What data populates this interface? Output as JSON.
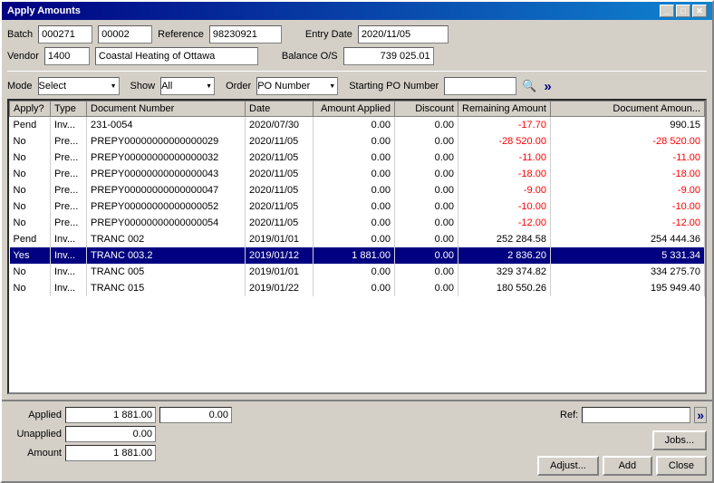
{
  "window": {
    "title": "Apply Amounts"
  },
  "header": {
    "batch_label": "Batch",
    "batch_value1": "000271",
    "batch_value2": "00002",
    "reference_label": "Reference",
    "reference_value": "98230921",
    "entry_date_label": "Entry Date",
    "entry_date_value": "2020/11/05",
    "vendor_label": "Vendor",
    "vendor_value": "1400",
    "vendor_name": "Coastal Heating of Ottawa",
    "balance_os_label": "Balance O/S",
    "balance_os_value": "739 025.01"
  },
  "filters": {
    "mode_label": "Mode",
    "mode_options": [
      "Select"
    ],
    "mode_selected": "Select",
    "show_label": "Show",
    "show_options": [
      "All"
    ],
    "show_selected": "All",
    "order_label": "Order",
    "order_options": [
      "PO Number"
    ],
    "order_selected": "PO Number",
    "starting_po_label": "Starting PO Number"
  },
  "table": {
    "columns": [
      "Apply?",
      "Type",
      "Document Number",
      "Date",
      "Amount Applied",
      "Discount",
      "Remaining Amount",
      "Document Amount"
    ],
    "rows": [
      {
        "apply": "Pend",
        "type": "Inv...",
        "doc": "231-0054",
        "date": "2020/07/30",
        "amount_applied": "0.00",
        "discount": "0.00",
        "remaining": "-17.70",
        "doc_amount": "990.15",
        "remaining_red": true,
        "doc_amount_red": false,
        "selected": false
      },
      {
        "apply": "No",
        "type": "Pre...",
        "doc": "PREPY00000000000000029",
        "date": "2020/11/05",
        "amount_applied": "0.00",
        "discount": "0.00",
        "remaining": "-28 520.00",
        "doc_amount": "-28 520.00",
        "remaining_red": true,
        "doc_amount_red": true,
        "selected": false
      },
      {
        "apply": "No",
        "type": "Pre...",
        "doc": "PREPY00000000000000032",
        "date": "2020/11/05",
        "amount_applied": "0.00",
        "discount": "0.00",
        "remaining": "-11.00",
        "doc_amount": "-11.00",
        "remaining_red": true,
        "doc_amount_red": true,
        "selected": false
      },
      {
        "apply": "No",
        "type": "Pre...",
        "doc": "PREPY00000000000000043",
        "date": "2020/11/05",
        "amount_applied": "0.00",
        "discount": "0.00",
        "remaining": "-18.00",
        "doc_amount": "-18.00",
        "remaining_red": true,
        "doc_amount_red": true,
        "selected": false
      },
      {
        "apply": "No",
        "type": "Pre...",
        "doc": "PREPY00000000000000047",
        "date": "2020/11/05",
        "amount_applied": "0.00",
        "discount": "0.00",
        "remaining": "-9.00",
        "doc_amount": "-9.00",
        "remaining_red": true,
        "doc_amount_red": true,
        "selected": false
      },
      {
        "apply": "No",
        "type": "Pre...",
        "doc": "PREPY00000000000000052",
        "date": "2020/11/05",
        "amount_applied": "0.00",
        "discount": "0.00",
        "remaining": "-10.00",
        "doc_amount": "-10.00",
        "remaining_red": true,
        "doc_amount_red": true,
        "selected": false
      },
      {
        "apply": "No",
        "type": "Pre...",
        "doc": "PREPY00000000000000054",
        "date": "2020/11/05",
        "amount_applied": "0.00",
        "discount": "0.00",
        "remaining": "-12.00",
        "doc_amount": "-12.00",
        "remaining_red": true,
        "doc_amount_red": true,
        "selected": false
      },
      {
        "apply": "Pend",
        "type": "Inv...",
        "doc": "TRANC 002",
        "date": "2019/01/01",
        "amount_applied": "0.00",
        "discount": "0.00",
        "remaining": "252 284.58",
        "doc_amount": "254 444.36",
        "remaining_red": false,
        "doc_amount_red": false,
        "selected": false
      },
      {
        "apply": "Yes",
        "type": "Inv...",
        "doc": "TRANC 003.2",
        "date": "2019/01/12",
        "amount_applied": "1 881.00",
        "discount": "0.00",
        "remaining": "2 836.20",
        "doc_amount": "5 331.34",
        "remaining_red": false,
        "doc_amount_red": false,
        "selected": true
      },
      {
        "apply": "No",
        "type": "Inv...",
        "doc": "TRANC 005",
        "date": "2019/01/01",
        "amount_applied": "0.00",
        "discount": "0.00",
        "remaining": "329 374.82",
        "doc_amount": "334 275.70",
        "remaining_red": false,
        "doc_amount_red": false,
        "selected": false
      },
      {
        "apply": "No",
        "type": "Inv...",
        "doc": "TRANC 015",
        "date": "2019/01/22",
        "amount_applied": "0.00",
        "discount": "0.00",
        "remaining": "180 550.26",
        "doc_amount": "195 949.40",
        "remaining_red": false,
        "doc_amount_red": false,
        "selected": false
      }
    ]
  },
  "bottom": {
    "applied_label": "Applied",
    "applied_value": "1 881.00",
    "applied_value2": "0.00",
    "unapplied_label": "Unapplied",
    "unapplied_value": "0.00",
    "amount_label": "Amount",
    "amount_value": "1 881.00",
    "ref_label": "Ref:",
    "ref_value": "",
    "jobs_label": "Jobs...",
    "adjust_label": "Adjust...",
    "add_label": "Add",
    "close_label": "Close"
  },
  "icons": {
    "minimize": "_",
    "maximize": "□",
    "close": "✕",
    "search": "🔍",
    "arrows_right": "»",
    "arrow_right2": "»"
  }
}
